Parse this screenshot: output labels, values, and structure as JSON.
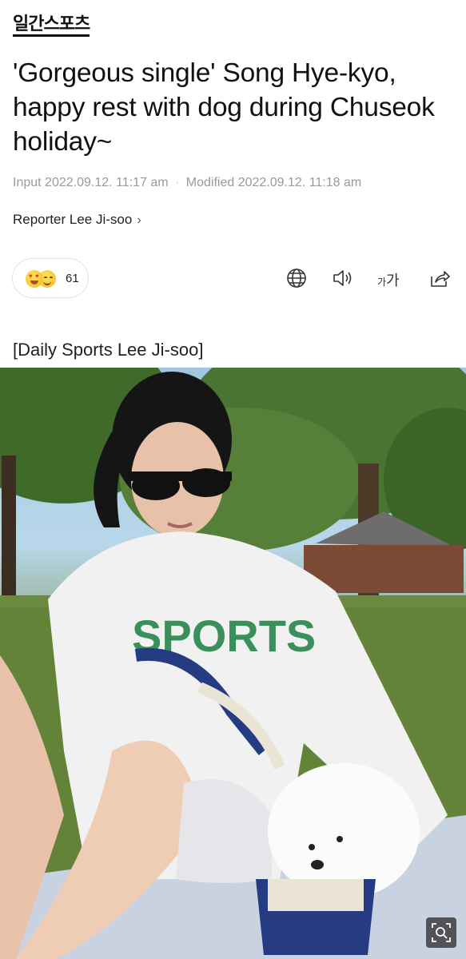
{
  "publisher": {
    "logo_text": "일간스포츠"
  },
  "article": {
    "headline": "'Gorgeous single' Song Hye-kyo, happy rest with dog during Chuseok holiday~",
    "input_label": "Input",
    "input_time": "2022.09.12. 11:17 am",
    "modified_label": "Modified",
    "modified_time": "2022.09.12. 11:18 am",
    "reporter": "Reporter Lee Ji-soo",
    "caption": "[Daily Sports Lee Ji-soo]"
  },
  "reactions": {
    "count": "61",
    "icons": [
      "heart-eyes-emoji-icon",
      "smiling-emoji-icon"
    ]
  },
  "toolbar": {
    "icons": [
      "globe-icon",
      "speaker-icon",
      "font-size-icon",
      "share-icon"
    ],
    "font_small": "가",
    "font_large": "가"
  },
  "photo": {
    "shirt_text": "SPORTS",
    "zoom_icon": "zoom-icon"
  },
  "colors": {
    "meta_gray": "#9a9a9a",
    "text": "#111111",
    "shirt_green": "#3a8f5a"
  }
}
